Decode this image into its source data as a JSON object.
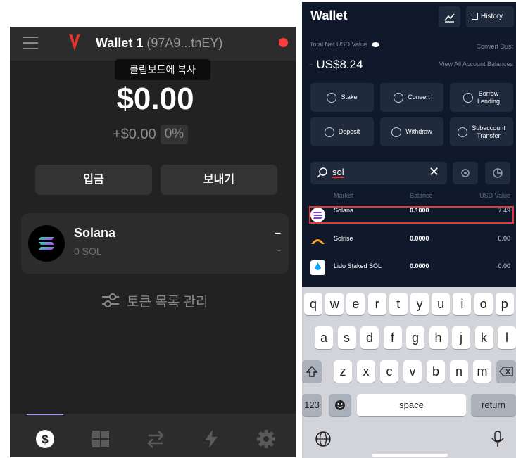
{
  "left": {
    "wallet_name": "Wallet 1",
    "wallet_address": "(97A9...tnEY)",
    "tooltip": "클립보드에 복사",
    "balance": "$0.00",
    "change_amount": "+$0.00",
    "change_percent": "0%",
    "deposit_label": "입금",
    "send_label": "보내기",
    "token": {
      "name": "Solana",
      "amount": "0 SOL",
      "value": "–",
      "change": "-"
    },
    "manage_tokens_label": "토큰 목록 관리",
    "tabs": [
      "dollar-icon",
      "grid-icon",
      "swap-icon",
      "lightning-icon",
      "gear-icon"
    ],
    "accent": "#ab9ff2",
    "status_color": "#ff3b3b"
  },
  "right": {
    "title": "Wallet",
    "history_label": "History",
    "total_label": "Total Net USD Value",
    "convert_dust": "Convert Dust",
    "usd_value": "US$8.24",
    "view_all": "View All Account Balances",
    "actions": [
      {
        "label": "Stake",
        "icon": "stake-icon"
      },
      {
        "label": "Convert",
        "icon": "convert-icon"
      },
      {
        "label": "Borrow\nLending",
        "icon": "borrow-icon"
      },
      {
        "label": "Deposit",
        "icon": "deposit-icon"
      },
      {
        "label": "Withdraw",
        "icon": "withdraw-icon"
      },
      {
        "label": "Subaccount\nTransfer",
        "icon": "transfer-icon"
      }
    ],
    "search_value": "sol",
    "columns": [
      "Market",
      "Balance",
      "USD Value"
    ],
    "rows": [
      {
        "name": "Solana",
        "balance": "0.1000",
        "usd": "7.49"
      },
      {
        "name": "Solrise",
        "balance": "0.0000",
        "usd": "0.00"
      },
      {
        "name": "Lido Staked SOL",
        "balance": "0.0000",
        "usd": "0.00"
      }
    ],
    "highlight_color": "#e53935",
    "keyboard": {
      "row1": [
        "q",
        "w",
        "e",
        "r",
        "t",
        "y",
        "u",
        "i",
        "o",
        "p"
      ],
      "row2": [
        "a",
        "s",
        "d",
        "f",
        "g",
        "h",
        "j",
        "k",
        "l"
      ],
      "row3": [
        "z",
        "x",
        "c",
        "v",
        "b",
        "n",
        "m"
      ],
      "numbers_key": "123",
      "space_key": "space",
      "return_key": "return"
    }
  }
}
